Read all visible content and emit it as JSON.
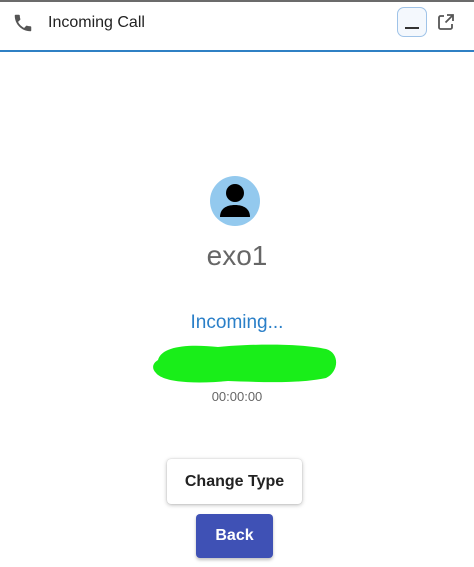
{
  "header": {
    "title": "Incoming Call",
    "icons": {
      "call": "phone-icon",
      "minimize": "minimize-icon",
      "popout": "popout-icon"
    }
  },
  "caller": {
    "name": "exo1",
    "avatar_icon": "user-icon"
  },
  "call": {
    "status": "Incoming...",
    "duration": "00:00:00"
  },
  "actions": {
    "change_type_label": "Change Type",
    "back_label": "Back"
  },
  "colors": {
    "accent_blue": "#2a7fc8",
    "header_border": "#2f80c4",
    "avatar_bg": "#93c9ee",
    "back_button": "#3f51b5",
    "redaction": "#19ee19"
  }
}
